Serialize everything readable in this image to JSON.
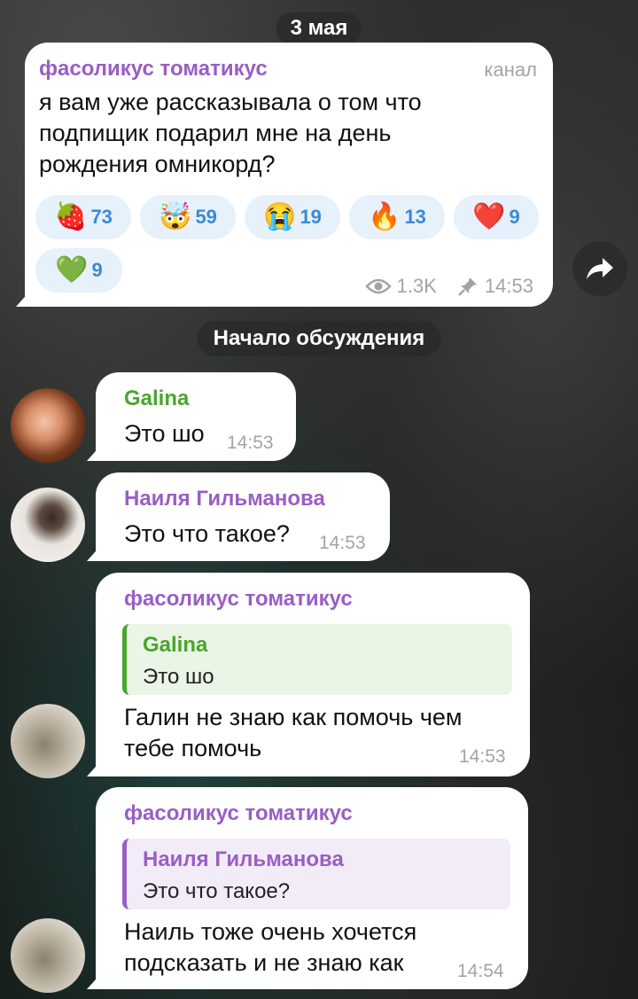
{
  "date_pill": "3 мая",
  "channel_post": {
    "sender": "фасоликус томатикус",
    "badge": "канал",
    "text": "я вам уже рассказывала о том что подпищик подарил мне на день рождения омникорд?",
    "reactions": [
      {
        "emoji": "🍓",
        "count": "73"
      },
      {
        "emoji": "🤯",
        "count": "59"
      },
      {
        "emoji": "😭",
        "count": "19"
      },
      {
        "emoji": "🔥",
        "count": "13"
      },
      {
        "emoji": "❤️",
        "count": "9"
      },
      {
        "emoji": "💚",
        "count": "9"
      }
    ],
    "views": "1.3K",
    "time": "14:53",
    "views_icon": "eye-icon",
    "pin_icon": "pin-icon"
  },
  "discussion_pill": "Начало обсуждения",
  "share_icon": "share-arrow-icon",
  "colors": {
    "purple": "#9a5ec4",
    "green": "#4aa52e",
    "reaction_bg": "#e6f1fb",
    "reaction_text": "#3a8ad6"
  },
  "messages": [
    {
      "sender": "Galina",
      "text": "Это шо",
      "time": "14:53"
    },
    {
      "sender": "Наиля Гильманова",
      "text": "Это что такое?",
      "time": "14:53"
    },
    {
      "sender": "фасоликус томатикус",
      "reply_name": "Galina",
      "reply_text": "Это шо",
      "text_lines": [
        "Галин не знаю как помочь чем",
        "тебе помочь"
      ],
      "time": "14:53"
    },
    {
      "sender": "фасоликус томатикус",
      "reply_name": "Наиля Гильманова",
      "reply_text": "Это что такое?",
      "text_lines": [
        "Наиль тоже очень хочется",
        "подсказать и не знаю как"
      ],
      "time": "14:54"
    }
  ]
}
